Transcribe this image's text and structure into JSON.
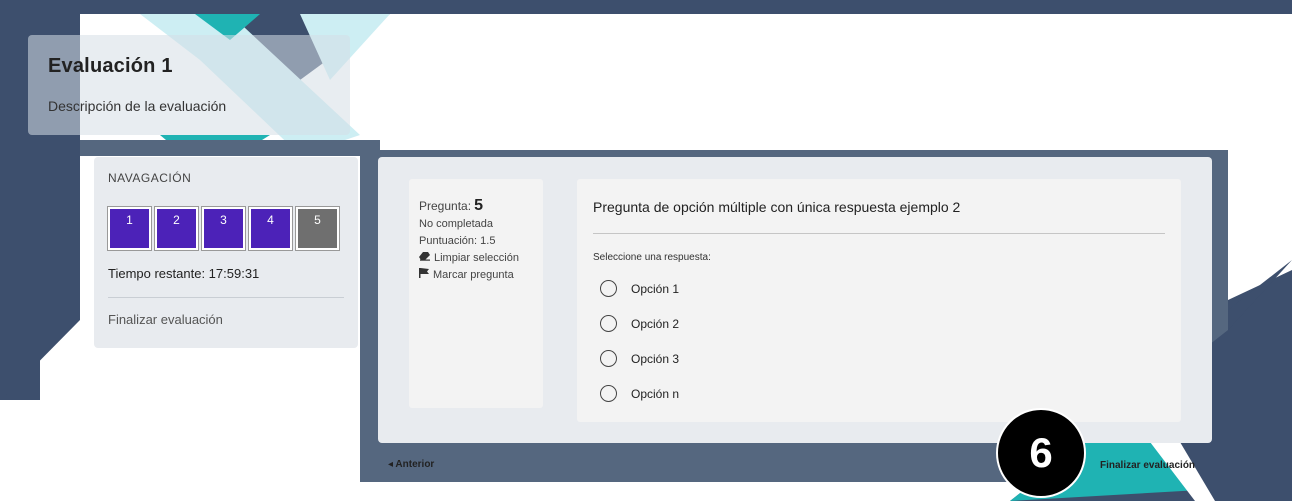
{
  "header": {
    "title": "Evaluación 1",
    "description": "Descripción de la evaluación"
  },
  "navigation": {
    "title": "NAVAGACIÓN",
    "questions": [
      "1",
      "2",
      "3",
      "4",
      "5"
    ],
    "current_question": "5",
    "timer_text": "Tiempo restante: 17:59:31",
    "finish_link": "Finalizar evaluación"
  },
  "question_info": {
    "label": "Pregunta:",
    "number": "5",
    "status": "No completada",
    "score": "Puntuación: 1.5",
    "clear_label": "Limpiar selección",
    "flag_label": "Marcar pregunta"
  },
  "question": {
    "text": "Pregunta de opción múltiple con única respuesta ejemplo 2",
    "prompt": "Seleccione una respuesta:",
    "options": [
      "Opción 1",
      "Opción 2",
      "Opción 3",
      "Opción n"
    ]
  },
  "footer": {
    "previous_label": "◂ Anterior",
    "finish_label": "Finalizar evaluación",
    "step_badge": "6"
  },
  "colors": {
    "dark_navy": "#3d4f6d",
    "teal": "#1fb3b3",
    "light_teal": "#cdeef3",
    "nav_box_answered": "#4c22b8",
    "nav_box_current": "#6f6f6f"
  },
  "icons": {
    "clear": "eraser-icon",
    "flag": "flag-icon"
  }
}
